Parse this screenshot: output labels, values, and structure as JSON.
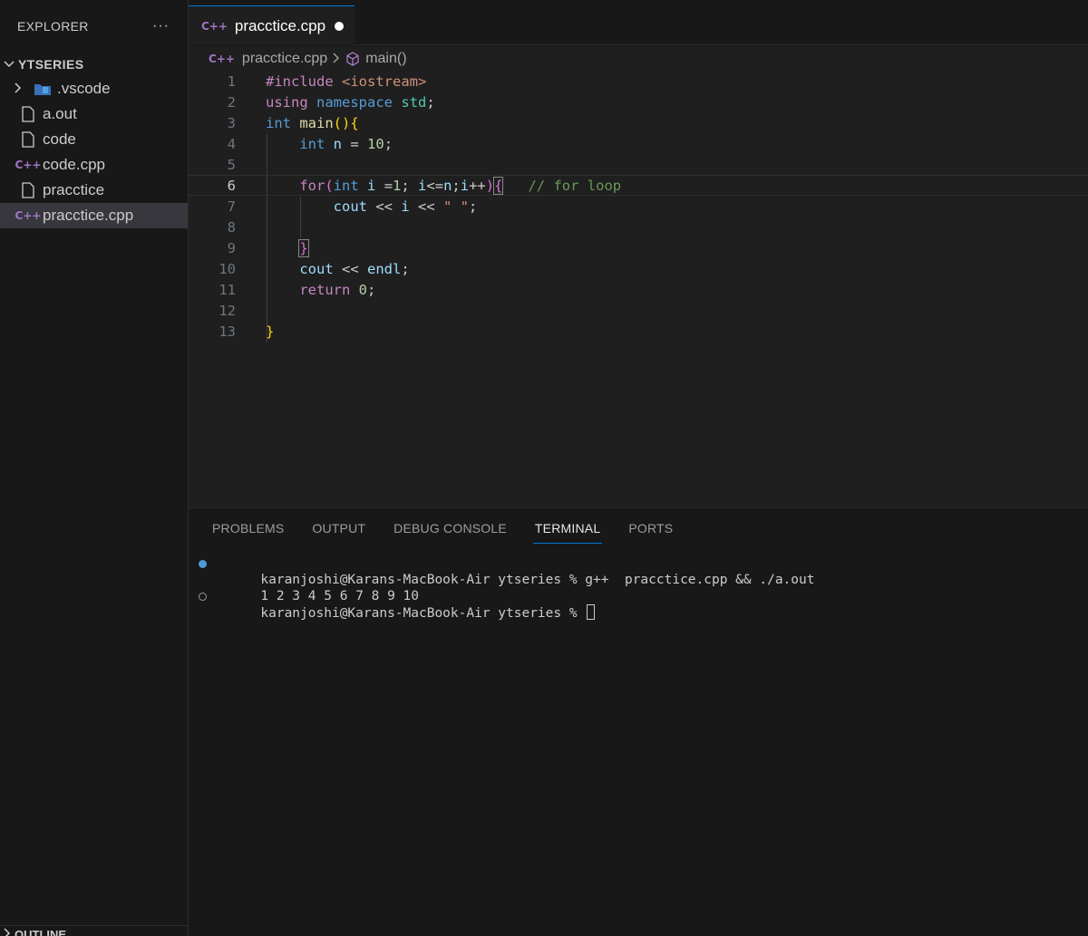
{
  "explorer": {
    "title": "EXPLORER",
    "more": "···",
    "folder": "YTSERIES",
    "items": [
      {
        "label": ".vscode",
        "type": "folder"
      },
      {
        "label": "a.out",
        "type": "file"
      },
      {
        "label": "code",
        "type": "file"
      },
      {
        "label": "code.cpp",
        "type": "cpp"
      },
      {
        "label": "pracctice",
        "type": "file"
      },
      {
        "label": "pracctice.cpp",
        "type": "cpp",
        "selected": true
      }
    ],
    "outline": "OUTLINE"
  },
  "tab": {
    "icon": "C++",
    "label": "pracctice.cpp",
    "dirty": true
  },
  "breadcrumb": {
    "file": "pracctice.cpp",
    "symbol": "main()"
  },
  "editor": {
    "current_line": 6,
    "line_numbers": [
      "1",
      "2",
      "3",
      "4",
      "5",
      "6",
      "7",
      "8",
      "9",
      "10",
      "11",
      "12",
      "13"
    ],
    "lines": [
      "#include <iostream>",
      "using namespace std;",
      "int main(){",
      "    int n = 10;",
      "",
      "    for(int i =1; i<=n;i++){   // for loop",
      "        cout << i << \" \";",
      "",
      "    }",
      "    cout << endl;",
      "    return 0;",
      "",
      "}"
    ]
  },
  "panel": {
    "tabs": [
      "PROBLEMS",
      "OUTPUT",
      "DEBUG CONSOLE",
      "TERMINAL",
      "PORTS"
    ],
    "active_tab": "TERMINAL",
    "terminal": {
      "line1": "karanjoshi@Karans-MacBook-Air ytseries % g++  pracctice.cpp && ./a.out",
      "line2": "1 2 3 4 5 6 7 8 9 10",
      "line3": "karanjoshi@Karans-MacBook-Air ytseries % "
    }
  },
  "colors": {
    "accent": "#0078d4",
    "cpp_icon": "#a074c4"
  }
}
